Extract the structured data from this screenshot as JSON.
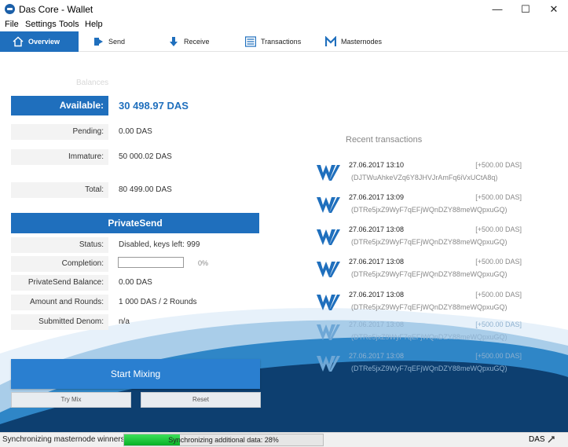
{
  "window": {
    "title": "Das Core - Wallet",
    "minimize": "—",
    "maximize": "☐",
    "close": "✕"
  },
  "menu": [
    "File",
    "Settings",
    "Tools",
    "Help"
  ],
  "tabs": [
    "Overview",
    "Send",
    "Receive",
    "Transactions",
    "Masternodes"
  ],
  "balances": {
    "title": "Balances",
    "available_label": "Available:",
    "available_value": "30 498.97 DAS",
    "pending_label": "Pending:",
    "pending_value": "0.00 DAS",
    "immature_label": "Immature:",
    "immature_value": "50 000.02 DAS",
    "total_label": "Total:",
    "total_value": "80 499.00 DAS"
  },
  "privatesend": {
    "title": "PrivateSend",
    "status_label": "Status:",
    "status_value": "Disabled, keys left: 999",
    "completion_label": "Completion:",
    "completion_percent": "0%",
    "completion_fraction": 0,
    "balance_label": "PrivateSend Balance:",
    "balance_value": "0.00 DAS",
    "amount_label": "Amount and Rounds:",
    "amount_value": "1 000 DAS / 2 Rounds",
    "denom_label": "Submitted Denom:",
    "denom_value": "n/a",
    "start_button": "Start Mixing",
    "try_button": "Try Mix",
    "reset_button": "Reset"
  },
  "recent": {
    "title": "Recent transactions",
    "items": [
      {
        "date": "27.06.2017 13:10",
        "amount": "[+500.00 DAS]",
        "address": "(DJTWuAhkeVZq6Y8JHVJrAmFq6iVxUCtA8q)"
      },
      {
        "date": "27.06.2017 13:09",
        "amount": "[+500.00 DAS]",
        "address": "(DTRe5jxZ9WyF7qEFjWQnDZY88meWQpxuGQ)"
      },
      {
        "date": "27.06.2017 13:08",
        "amount": "[+500.00 DAS]",
        "address": "(DTRe5jxZ9WyF7qEFjWQnDZY88meWQpxuGQ)"
      },
      {
        "date": "27.06.2017 13:08",
        "amount": "[+500.00 DAS]",
        "address": "(DTRe5jxZ9WyF7qEFjWQnDZY88meWQpxuGQ)"
      },
      {
        "date": "27.06.2017 13:08",
        "amount": "[+500.00 DAS]",
        "address": "(DTRe5jxZ9WyF7qEFjWQnDZY88meWQpxuGQ)"
      },
      {
        "date": "27.06.2017 13:08",
        "amount": "[+500.00 DAS]",
        "address": "(DTRe5jxZ9WyF7qEFjWQnDZY88meWQpxuGQ)"
      },
      {
        "date": "27.06.2017 13:08",
        "amount": "[+500.00 DAS]",
        "address": "(DTRe5jxZ9WyF7qEFjWQnDZY88meWQpxuGQ)"
      }
    ]
  },
  "status": {
    "text": "Synchronizing masternode winners...",
    "sync_text": "Synchronizing additional data: 28%",
    "sync_fraction": 0.28,
    "unit": "DAS"
  },
  "colors": {
    "accent": "#1f6fbd",
    "progress_green": "#06b025"
  },
  "icons": {
    "overview": "home-icon",
    "send": "send-icon",
    "receive": "receive-icon",
    "transactions": "transactions-icon",
    "masternodes": "masternodes-icon",
    "tx": "das-logo-icon",
    "sync": "sync-icon"
  }
}
